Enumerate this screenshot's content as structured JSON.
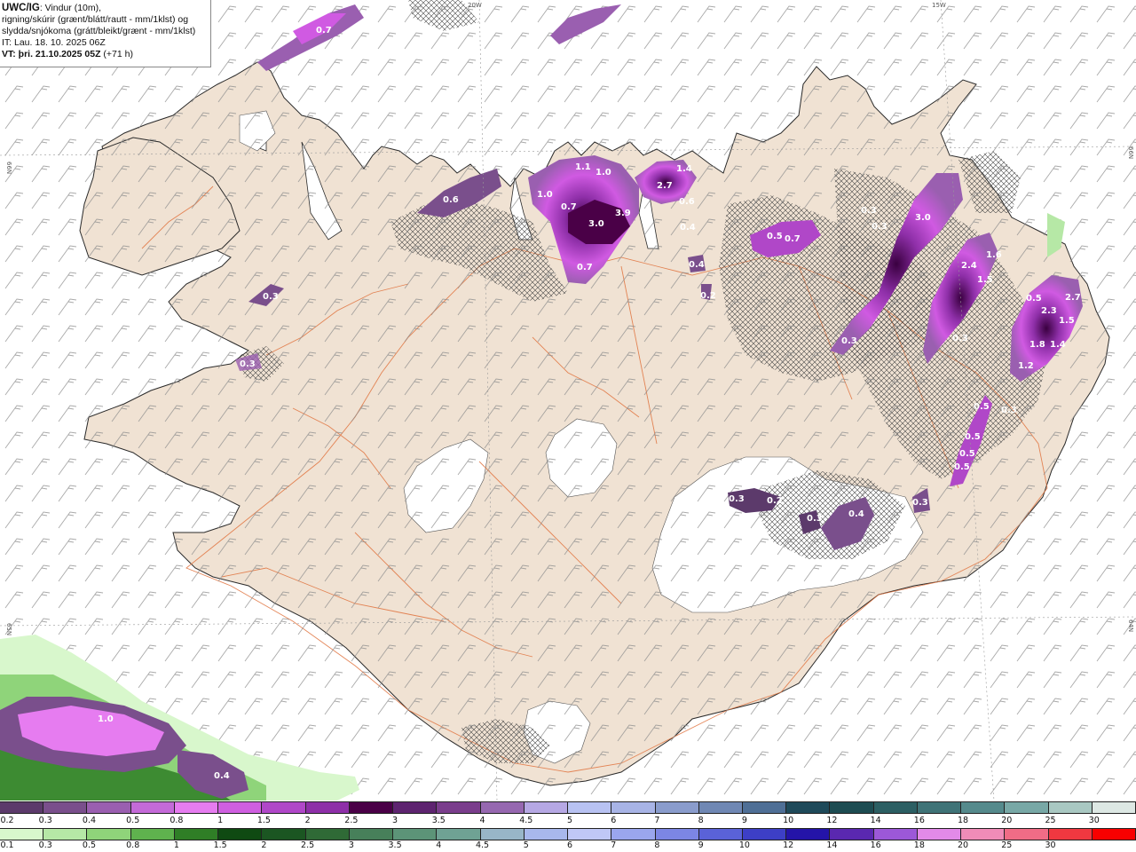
{
  "header": {
    "title": "UWC/IG",
    "desc_line1": ": Vindur (10m),",
    "desc_line2": "rigning/skúrir (grænt/blátt/rautt - mm/1klst) og",
    "desc_line3": "slydda/snjókoma (grátt/bleikt/grænt - mm/1klst)",
    "it_line": "IT: Lau. 18. 10. 2025 06Z",
    "vt_label": "VT: þri. 21.10.2025 05Z",
    "vt_offset": " (+71 h)"
  },
  "grid_labels": {
    "lon_20w": "20W",
    "lon_15w": "15W",
    "lat_66n_left": "66N",
    "lat_65n_left": "65N",
    "lat_66n_right": "66N",
    "lat_64n_right": "64N"
  },
  "precip_labels": [
    "0.7",
    "0.6",
    "1.1",
    "1.0",
    "1.0",
    "0.7",
    "3.0",
    "3.9",
    "0.7",
    "1.4",
    "2.7",
    "0.6",
    "0.4",
    "0.4",
    "0.2",
    "0.5",
    "0.7",
    "0.3",
    "0.3",
    "3.0",
    "2.4",
    "1.6",
    "1.5",
    "0.3",
    "0.3",
    "0.5",
    "2.3",
    "2.7",
    "1.8",
    "1.4",
    "1.5",
    "1.2",
    "0.3",
    "0.5",
    "0.5",
    "0.5",
    "0.5",
    "0.3",
    "0.2",
    "0.3",
    "0.4",
    "0.3",
    "0.3",
    "0.3",
    "1.0",
    "0.4"
  ],
  "legend": {
    "snow_scale_labels": [
      "0.2",
      "0.3",
      "0.4",
      "0.5",
      "0.8",
      "1",
      "1.5",
      "2",
      "2.5",
      "3",
      "3.5",
      "4",
      "4.5",
      "5",
      "6",
      "7",
      "8",
      "9",
      "10",
      "12",
      "14",
      "16",
      "18",
      "20",
      "25",
      "30"
    ],
    "snow_colors": [
      "#5c3a6b",
      "#7a4f8c",
      "#9a5fb0",
      "#c46ad8",
      "#e67cf0",
      "#cf5fe0",
      "#b047c8",
      "#8e2fa8",
      "#4a0047",
      "#5e2470",
      "#7a3d8c",
      "#9668b0",
      "#b6a8e4",
      "#b8c2f2",
      "#a8b4e6",
      "#8a9ccc",
      "#7088b4",
      "#4f6f96",
      "#1f4a5a",
      "#1d4c52",
      "#2c5f63",
      "#3f7377",
      "#558a8c",
      "#78a8a6",
      "#a9c8c2",
      "#dde8e4"
    ],
    "rain_scale_labels": [
      "0.1",
      "0.3",
      "0.5",
      "0.8",
      "1",
      "1.5",
      "2",
      "2.5",
      "3",
      "3.5",
      "4",
      "4.5",
      "5",
      "6",
      "7",
      "8",
      "9",
      "10",
      "12",
      "14",
      "16",
      "18",
      "20",
      "25",
      "30"
    ],
    "rain_colors": [
      "#d8f7cc",
      "#b6e8a6",
      "#8fd47a",
      "#5fb24e",
      "#2f7e26",
      "#0f4a12",
      "#1b5622",
      "#2f6a36",
      "#47805a",
      "#5c9478",
      "#6fa294",
      "#98b6c8",
      "#a8b8ec",
      "#c0c8f6",
      "#9aa6ee",
      "#7c86e4",
      "#5a62d8",
      "#3d3fc6",
      "#2414a8",
      "#5a28b0",
      "#9c58d8",
      "#e28ae8",
      "#f08cb8",
      "#f06c86",
      "#f03840",
      "#f80000"
    ]
  },
  "map_style": {
    "land_color": "#f0e2d3",
    "ice_color": "#ffffff",
    "coast_color": "#222222",
    "road_color": "#e0733e",
    "barb_color": "#8a8a8a",
    "sea_color": "#ffffff"
  }
}
